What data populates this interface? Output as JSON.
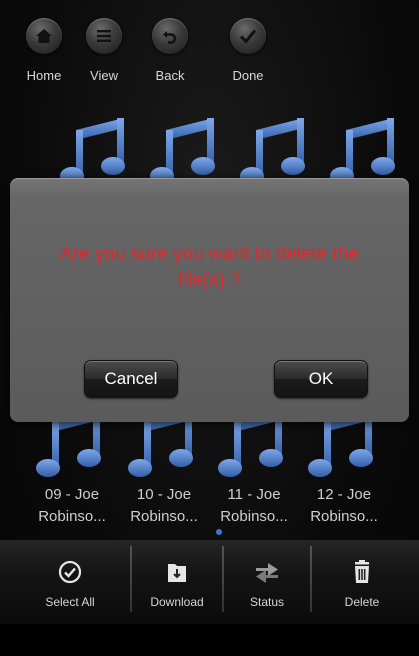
{
  "toolbar": {
    "home": "Home",
    "view": "View",
    "back": "Back",
    "done": "Done"
  },
  "files": [
    {
      "line1": "09 - Joe",
      "line2": "Robinso..."
    },
    {
      "line1": "10 - Joe",
      "line2": "Robinso..."
    },
    {
      "line1": "11 - Joe",
      "line2": "Robinso..."
    },
    {
      "line1": "12 - Joe",
      "line2": "Robinso..."
    }
  ],
  "dialog": {
    "message": "Are you sure you want to delete the file(s) ?",
    "cancel": "Cancel",
    "ok": "OK"
  },
  "bottom": {
    "select_all": "Select All",
    "download": "Download",
    "status": "Status",
    "delete": "Delete"
  },
  "colors": {
    "note_blue": "#4c7fd0",
    "alert_text": "#e0282c"
  }
}
